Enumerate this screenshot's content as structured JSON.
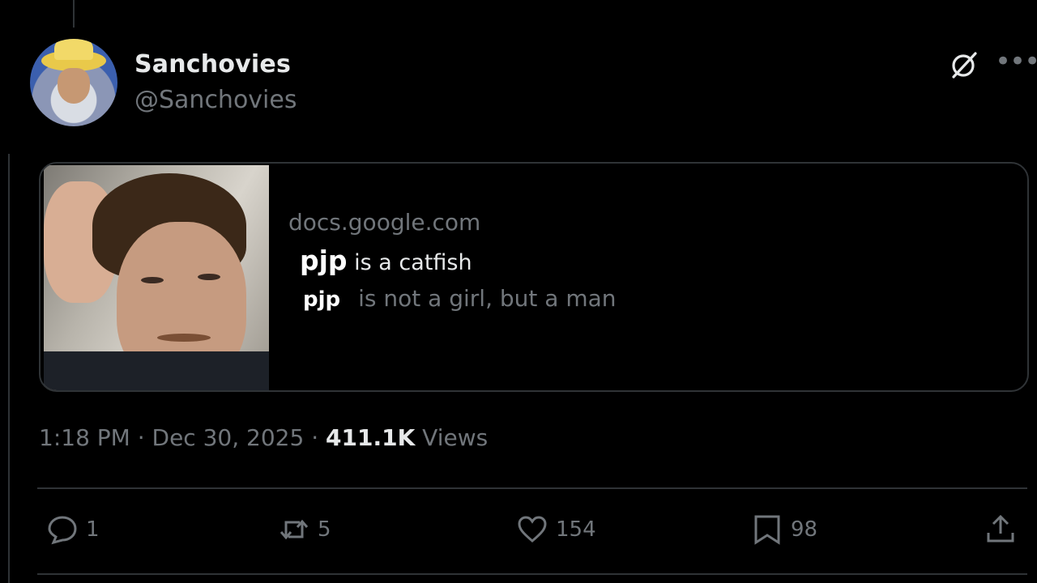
{
  "tweet": {
    "author_name": "Sanchovies",
    "author_handle": "@Sanchovies",
    "timestamp": "1:18 PM · Dec 30, 2025 · ",
    "views_count": "411.1K",
    "views_label": " Views"
  },
  "card": {
    "domain": "docs.google.com",
    "line1_name": "pjp",
    "line1_text": " is a catfish",
    "line2_name": "pjp",
    "line2_text": "is not a girl, but a man"
  },
  "actions": {
    "replies": "1",
    "reposts": "5",
    "likes": "154",
    "bookmarks": "98"
  },
  "icons": {
    "grok": "grok-icon",
    "more": "more-icon",
    "reply": "reply-icon",
    "repost": "repost-icon",
    "like": "heart-icon",
    "bookmark": "bookmark-icon",
    "share": "share-icon"
  },
  "colors": {
    "background": "#000000",
    "primary_text": "#e7e9ea",
    "secondary_text": "#71767b",
    "border": "#2f3336"
  }
}
